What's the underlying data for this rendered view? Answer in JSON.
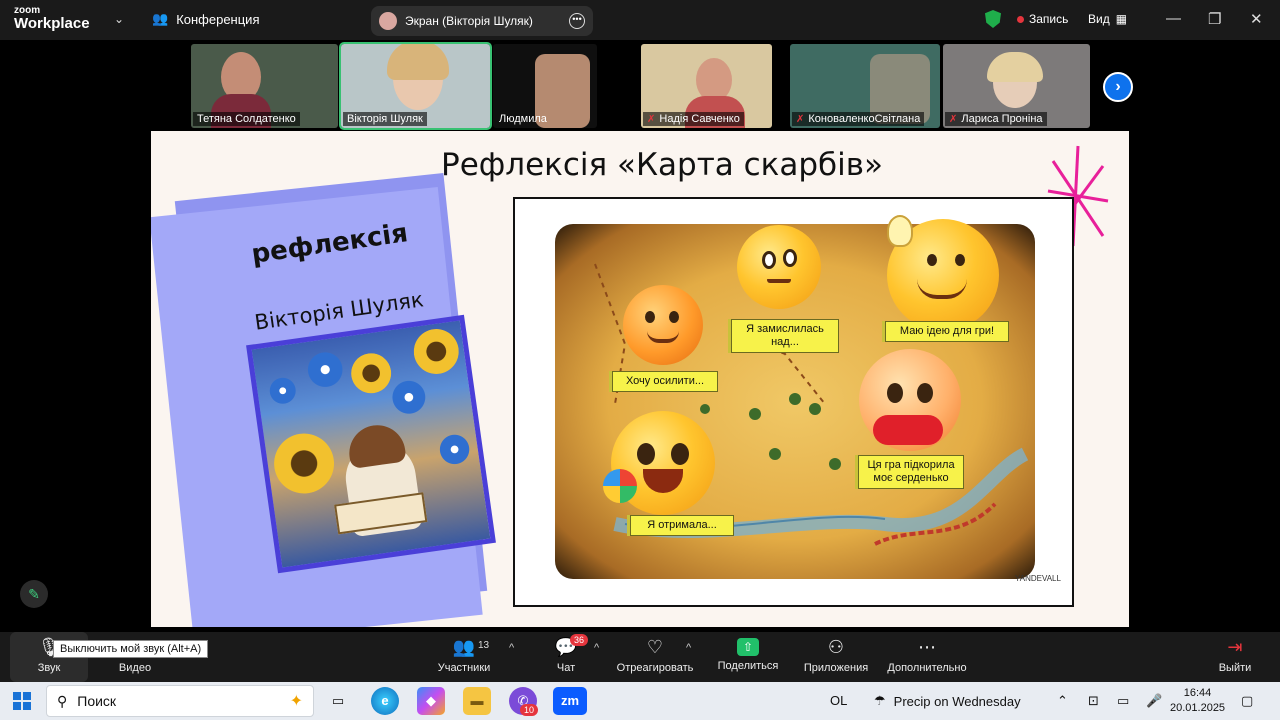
{
  "app": {
    "brand_top": "zoom",
    "brand_bottom": "Workplace",
    "conference_label": "Конференция"
  },
  "screen_share": {
    "label": "Экран (Вікторія Шуляк)"
  },
  "status": {
    "recording_label": "Запись",
    "view_label": "Вид"
  },
  "participants": [
    {
      "name": "Тетяна Солдатенко",
      "muted": false
    },
    {
      "name": "Вікторія Шуляк",
      "muted": false,
      "active": true
    },
    {
      "name": "Людмила",
      "muted": false
    },
    {
      "name": "Надія Савченко",
      "muted": true
    },
    {
      "name": "КоноваленкоСвітлана",
      "muted": true
    },
    {
      "name": "Лариса Проніна",
      "muted": true
    }
  ],
  "slide": {
    "title": "Рефлексія «Карта скарбів»",
    "paper_title": "рефлексія",
    "paper_author": "Вікторія Шуляк",
    "labels": {
      "thinking": "Я замислилась над...",
      "idea": "Маю ідею для гри!",
      "stronger": "Хочу осилити...",
      "heart": "Ця гра підкорила моє серденько",
      "received": "Я отримала..."
    },
    "map_signature": "YANDEVALL"
  },
  "tooltip": "Выключить мой звук (Alt+A)",
  "toolbar": {
    "audio": "Звук",
    "video": "Видео",
    "participants": "Участники",
    "participants_count": "13",
    "chat": "Чат",
    "chat_badge": "36",
    "react": "Отреагировать",
    "share": "Поделиться",
    "apps": "Приложения",
    "more": "Дополнительно",
    "leave": "Выйти"
  },
  "taskbar": {
    "search_placeholder": "Поиск",
    "app_badge": "10",
    "tray_ol": "OL",
    "weather": "Precip on Wednesday",
    "time": "16:44",
    "date": "20.01.2025"
  }
}
